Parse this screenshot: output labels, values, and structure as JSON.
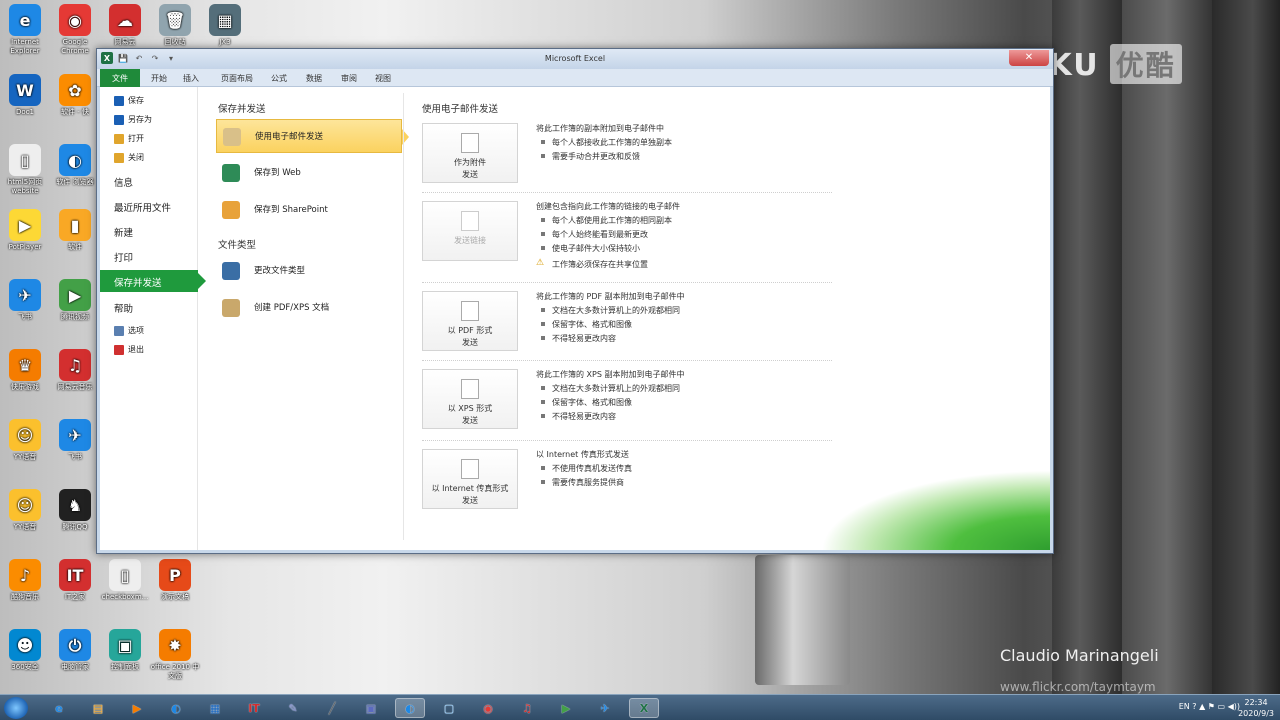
{
  "desktop": {
    "icons": [
      {
        "label": "Internet Explorer",
        "color": "#1e88e5",
        "glyph": "e"
      },
      {
        "label": "Google Chrome",
        "color": "#e53935",
        "glyph": "◉"
      },
      {
        "label": "网易云",
        "color": "#d32f2f",
        "glyph": "☁"
      },
      {
        "label": "回收站",
        "color": "#90a4ae",
        "glyph": "🗑"
      },
      {
        "label": "JX3",
        "color": "#546e7a",
        "glyph": "▦"
      },
      {
        "label": "Doc1",
        "color": "#1565c0",
        "glyph": "W"
      },
      {
        "label": "软件 - 快",
        "color": "#fb8c00",
        "glyph": "✿"
      },
      {
        "label": "html5网页 website",
        "color": "#eeeeee",
        "glyph": "▯"
      },
      {
        "label": "软件 浏览器",
        "color": "#1e88e5",
        "glyph": "◐"
      },
      {
        "label": "PotPlayer",
        "color": "#fdd835",
        "glyph": "▶"
      },
      {
        "label": "软件",
        "color": "#f9a825",
        "glyph": "▮"
      },
      {
        "label": "飞书",
        "color": "#1e88e5",
        "glyph": "✈"
      },
      {
        "label": "腾讯视频",
        "color": "#43a047",
        "glyph": "▶"
      },
      {
        "label": "快乐游戏",
        "color": "#f57c00",
        "glyph": "♛"
      },
      {
        "label": "网易云音乐",
        "color": "#d32f2f",
        "glyph": "♫"
      },
      {
        "label": "YY语音",
        "color": "#fbc02d",
        "glyph": "☺"
      },
      {
        "label": "飞书",
        "color": "#1e88e5",
        "glyph": "✈"
      },
      {
        "label": "YY语音",
        "color": "#fbc02d",
        "glyph": "☺"
      },
      {
        "label": "腾讯QQ",
        "color": "#212121",
        "glyph": "♞"
      },
      {
        "label": "酷狗音乐",
        "color": "#fb8c00",
        "glyph": "♪"
      },
      {
        "label": "IT之家",
        "color": "#d32f2f",
        "glyph": "IT"
      },
      {
        "label": "checkboxm...",
        "color": "#eeeeee",
        "glyph": "▯"
      },
      {
        "label": "演示文稿",
        "color": "#e64a19",
        "glyph": "P"
      },
      {
        "label": "360安全",
        "color": "#0288d1",
        "glyph": "☻"
      },
      {
        "label": "电脑管家",
        "color": "#1e88e5",
        "glyph": "⏻"
      },
      {
        "label": "控制面板",
        "color": "#26a69a",
        "glyph": "▣"
      },
      {
        "label": "office 2010 中文版",
        "color": "#f57c00",
        "glyph": "✸"
      }
    ],
    "watermark": {
      "latin": "YOUKU",
      "cn": "优酷"
    },
    "credit": "Claudio Marinangeli",
    "credit_url": "www.flickr.com/taymtaym"
  },
  "excel": {
    "window_title": "Microsoft Excel",
    "close_glyph": "✕",
    "qat": [
      "X",
      "💾",
      "↶",
      "↷",
      "▾"
    ],
    "tabs": [
      "文件",
      "开始",
      "插入",
      "页面布局",
      "公式",
      "数据",
      "审阅",
      "视图"
    ],
    "nav_small_top": [
      {
        "label": "保存",
        "color": "#1a5fb4"
      },
      {
        "label": "另存为",
        "color": "#1a5fb4"
      },
      {
        "label": "打开",
        "color": "#e0a52c"
      },
      {
        "label": "关闭",
        "color": "#e0a52c"
      }
    ],
    "nav_big": [
      "信息",
      "最近所用文件",
      "新建",
      "打印",
      "保存并发送",
      "帮助"
    ],
    "nav_small_bottom": [
      {
        "label": "选项",
        "color": "#5a7fb0"
      },
      {
        "label": "退出",
        "color": "#d03030"
      }
    ],
    "mid": {
      "section1": "保存并发送",
      "items1": [
        {
          "label": "使用电子邮件发送",
          "color": "#d9c089"
        },
        {
          "label": "保存到 Web",
          "color": "#2e8b57"
        },
        {
          "label": "保存到 SharePoint",
          "color": "#e8a23a"
        }
      ],
      "section2": "文件类型",
      "items2": [
        {
          "label": "更改文件类型",
          "color": "#3a6ea5"
        },
        {
          "label": "创建 PDF/XPS 文档",
          "color": "#c9a86b"
        }
      ]
    },
    "right": {
      "title": "使用电子邮件发送",
      "actions": [
        {
          "button": [
            "作为附件",
            "发送"
          ],
          "enabled": true,
          "desc_title": "将此工作簿的副本附加到电子邮件中",
          "bullets": [
            "每个人都接收此工作簿的单独副本",
            "需要手动合并更改和反馈"
          ],
          "warning": ""
        },
        {
          "button": [
            "发送链接"
          ],
          "enabled": false,
          "desc_title": "创建包含指向此工作簿的链接的电子邮件",
          "bullets": [
            "每个人都使用此工作簿的相同副本",
            "每个人始终能看到最新更改",
            "使电子邮件大小保持较小"
          ],
          "warning": "工作簿必须保存在共享位置"
        },
        {
          "button": [
            "以 PDF 形式",
            "发送"
          ],
          "enabled": true,
          "desc_title": "将此工作簿的 PDF 副本附加到电子邮件中",
          "bullets": [
            "文档在大多数计算机上的外观都相同",
            "保留字体、格式和图像",
            "不得轻易更改内容"
          ],
          "warning": ""
        },
        {
          "button": [
            "以 XPS 形式",
            "发送"
          ],
          "enabled": true,
          "desc_title": "将此工作簿的 XPS 副本附加到电子邮件中",
          "bullets": [
            "文档在大多数计算机上的外观都相同",
            "保留字体、格式和图像",
            "不得轻易更改内容"
          ],
          "warning": ""
        },
        {
          "button": [
            "以 Internet 传真形式",
            "发送"
          ],
          "enabled": true,
          "desc_title": "以 Internet 传真形式发送",
          "bullets": [
            "不使用传真机发送传真",
            "需要传真服务提供商"
          ],
          "warning": ""
        }
      ]
    }
  },
  "taskbar": {
    "apps": [
      {
        "glyph": "e",
        "color": "#1e88e5",
        "active": false
      },
      {
        "glyph": "▤",
        "color": "#f9a825",
        "active": false
      },
      {
        "glyph": "▶",
        "color": "#f57c00",
        "active": false
      },
      {
        "glyph": "◐",
        "color": "#1e88e5",
        "active": false
      },
      {
        "glyph": "▦",
        "color": "#1565c0",
        "active": false
      },
      {
        "glyph": "IT",
        "color": "#d32f2f",
        "active": false
      },
      {
        "glyph": "✎",
        "color": "#7986cb",
        "active": false
      },
      {
        "glyph": "╱",
        "color": "#616161",
        "active": false
      },
      {
        "glyph": "▣",
        "color": "#5c6bc0",
        "active": false
      },
      {
        "glyph": "◐",
        "color": "#1e88e5",
        "active": true
      },
      {
        "glyph": "▢",
        "color": "#90caf9",
        "active": false
      },
      {
        "glyph": "◉",
        "color": "#e53935",
        "active": false
      },
      {
        "glyph": "♫",
        "color": "#d32f2f",
        "active": false
      },
      {
        "glyph": "▶",
        "color": "#43a047",
        "active": false
      },
      {
        "glyph": "✈",
        "color": "#1e88e5",
        "active": false
      },
      {
        "glyph": "X",
        "color": "#1e7145",
        "active": true
      }
    ],
    "tray": "EN ? ▲ ⚑ ▭ ◀))",
    "time": "22:34",
    "date": "2020/9/3"
  }
}
